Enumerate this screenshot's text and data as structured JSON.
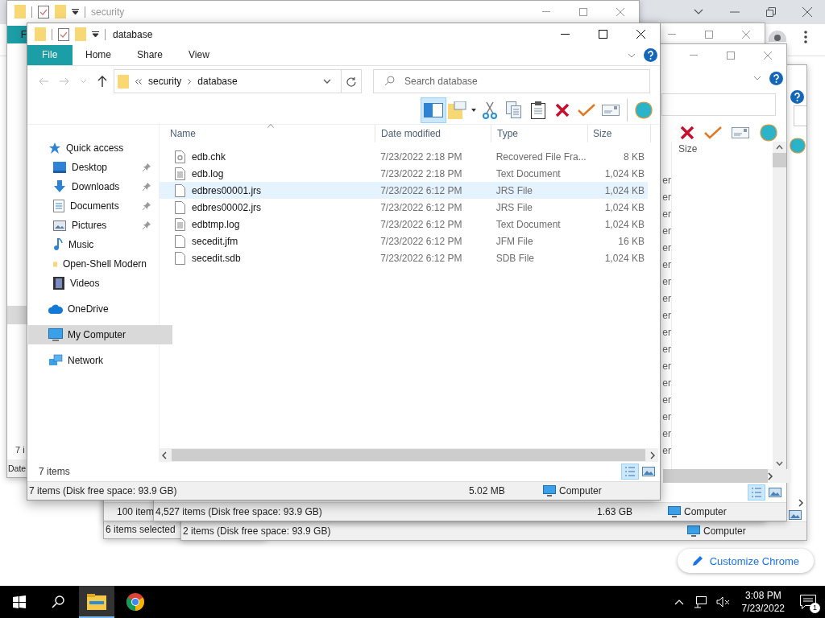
{
  "browser": {
    "customize_button": "Customize Chrome"
  },
  "window_e": {
    "status_text": "6 items selected"
  },
  "window_d": {
    "status_text": "2 items (Disk free space: 93.9 GB)",
    "location": "Computer"
  },
  "window_b": {
    "status_text": "100 item"
  },
  "window_c": {
    "column": "Size",
    "type_fragments": [
      "er",
      "er",
      "er",
      "er",
      "er",
      "er",
      "er",
      "er",
      "er",
      "er",
      "er",
      "er",
      "er",
      "er",
      "er",
      "er",
      "er"
    ],
    "status_text": "4,527 items (Disk free space: 93.9 GB)",
    "size": "1.63 GB",
    "location": "Computer"
  },
  "window_a": {
    "title": "security",
    "ribbon_tab": "F",
    "item_count": "7 i",
    "column": "Date"
  },
  "explorer": {
    "title": "database",
    "ribbon_tabs": [
      {
        "label": "File",
        "selected": true
      },
      {
        "label": "Home",
        "selected": false
      },
      {
        "label": "Share",
        "selected": false
      },
      {
        "label": "View",
        "selected": false
      }
    ],
    "address": {
      "path": [
        "security",
        "database"
      ]
    },
    "search": {
      "placeholder": "Search database"
    },
    "navigation": [
      {
        "label": "Quick access",
        "kind": "star",
        "selected": false,
        "children": [
          {
            "label": "Desktop",
            "kind": "desktop",
            "pinned": true,
            "selected": false
          },
          {
            "label": "Downloads",
            "kind": "download",
            "pinned": true,
            "selected": false
          },
          {
            "label": "Documents",
            "kind": "document",
            "pinned": true,
            "selected": false
          },
          {
            "label": "Pictures",
            "kind": "picture",
            "pinned": true,
            "selected": false
          },
          {
            "label": "Music",
            "kind": "music",
            "pinned": false,
            "selected": false
          },
          {
            "label": "Open-Shell Modern",
            "kind": "folder",
            "pinned": false,
            "selected": false
          },
          {
            "label": "Videos",
            "kind": "video",
            "pinned": false,
            "selected": false
          }
        ]
      },
      {
        "label": "OneDrive",
        "kind": "cloud",
        "selected": false
      },
      {
        "label": "My Computer",
        "kind": "computer",
        "selected": true
      },
      {
        "label": "Network",
        "kind": "network",
        "selected": false
      }
    ],
    "columns": [
      "Name",
      "Date modified",
      "Type",
      "Size"
    ],
    "files": [
      {
        "name": "edb.chk",
        "date": "7/23/2022 2:18 PM",
        "type": "Recovered File Fra...",
        "size": "8 KB",
        "kind": "chk",
        "selected": false
      },
      {
        "name": "edb.log",
        "date": "7/23/2022 2:18 PM",
        "type": "Text Document",
        "size": "1,024 KB",
        "kind": "text",
        "selected": false
      },
      {
        "name": "edbres00001.jrs",
        "date": "7/23/2022 6:12 PM",
        "type": "JRS File",
        "size": "1,024 KB",
        "kind": "blank",
        "selected": true
      },
      {
        "name": "edbres00002.jrs",
        "date": "7/23/2022 6:12 PM",
        "type": "JRS File",
        "size": "1,024 KB",
        "kind": "blank",
        "selected": false
      },
      {
        "name": "edbtmp.log",
        "date": "7/23/2022 6:12 PM",
        "type": "Text Document",
        "size": "1,024 KB",
        "kind": "text",
        "selected": false
      },
      {
        "name": "secedit.jfm",
        "date": "7/23/2022 6:12 PM",
        "type": "JFM File",
        "size": "16 KB",
        "kind": "blank",
        "selected": false
      },
      {
        "name": "secedit.sdb",
        "date": "7/23/2022 6:12 PM",
        "type": "SDB File",
        "size": "1,024 KB",
        "kind": "blank",
        "selected": false
      }
    ],
    "item_count": "7 items",
    "status_bar": {
      "text": "7 items (Disk free space: 93.9 GB)",
      "size": "5.02 MB",
      "location": "Computer"
    }
  },
  "taskbar": {
    "apps": [
      {
        "kind": "explorer",
        "active": true
      },
      {
        "kind": "chrome",
        "active": false
      }
    ],
    "time": "3:08 PM",
    "date": "7/23/2022",
    "notifications": "1"
  }
}
